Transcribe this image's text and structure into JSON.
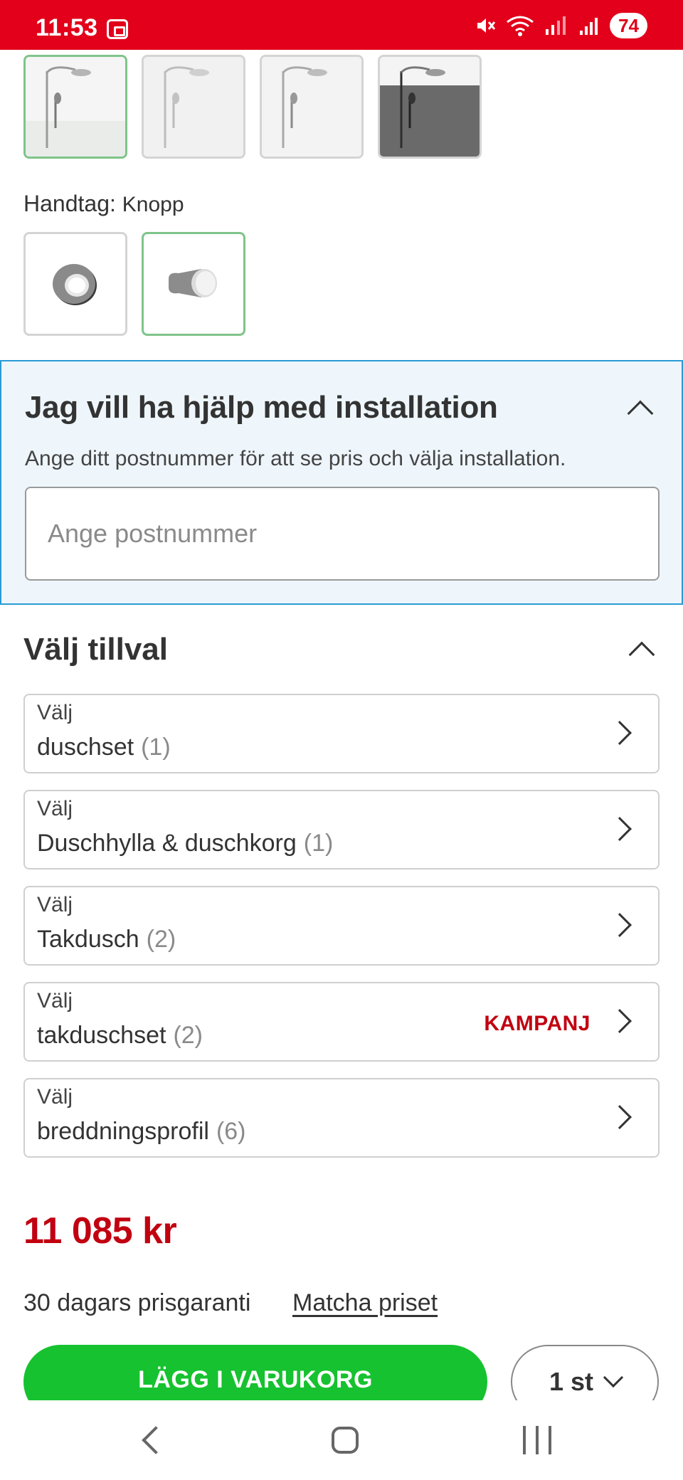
{
  "status_bar": {
    "time": "11:53",
    "battery": "74",
    "icons": [
      "screenshot-icon",
      "mute-icon",
      "wifi-icon",
      "signal-icon",
      "signal-icon-2"
    ]
  },
  "colors": {
    "brand_red": "#e2001a",
    "price_red": "#c10010",
    "cta_green": "#16c22f",
    "selected_border": "#7fc48a",
    "install_bg": "#eef6fb",
    "install_border": "#2a9bd6"
  },
  "variant_images": {
    "selected_index": 0,
    "count": 4
  },
  "handle": {
    "label": "Handtag:",
    "value": "Knopp",
    "selected_index": 1,
    "options": [
      "ring-handle",
      "knob-handle"
    ]
  },
  "installation": {
    "title": "Jag vill ha hjälp med installation",
    "description": "Ange ditt postnummer för att se pris och välja installation.",
    "zip_placeholder": "Ange postnummer",
    "zip_value": ""
  },
  "addons": {
    "title": "Välj tillval",
    "items": [
      {
        "prefix": "Välj",
        "name": "duschset",
        "count": "(1)",
        "badge": ""
      },
      {
        "prefix": "Välj",
        "name": "Duschhylla & duschkorg",
        "count": "(1)",
        "badge": ""
      },
      {
        "prefix": "Välj",
        "name": "Takdusch",
        "count": "(2)",
        "badge": ""
      },
      {
        "prefix": "Välj",
        "name": "takduschset",
        "count": "(2)",
        "badge": "KAMPANJ"
      },
      {
        "prefix": "Välj",
        "name": "breddningsprofil",
        "count": "(6)",
        "badge": ""
      }
    ]
  },
  "purchase": {
    "price": "11 085 kr",
    "guarantee": "30 dagars prisgaranti",
    "match_link": "Matcha priset",
    "add_to_cart": "LÄGG I VARUKORG",
    "quantity": "1 st"
  }
}
